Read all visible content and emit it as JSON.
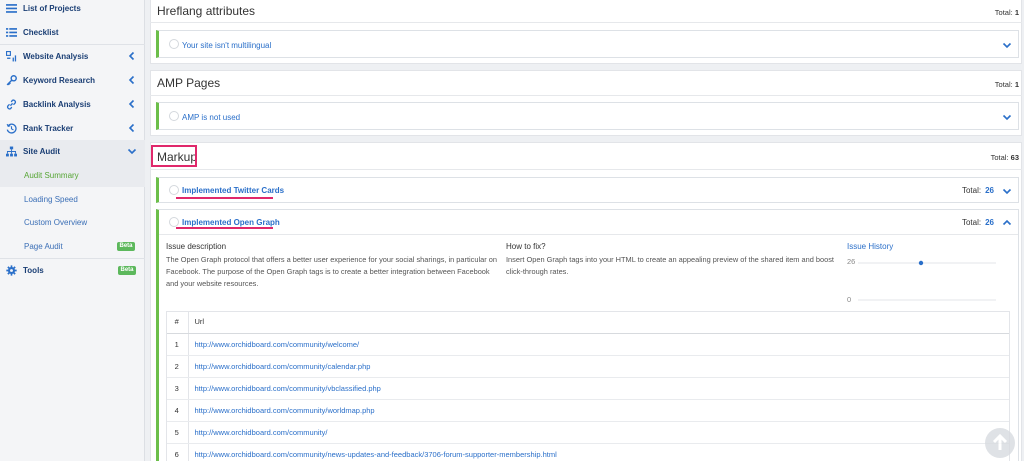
{
  "sidebar": {
    "items": [
      {
        "label": "List of Projects",
        "icon": "list-icon"
      },
      {
        "label": "Checklist",
        "icon": "checklist-icon"
      },
      {
        "label": "Website Analysis",
        "icon": "website-analysis-icon"
      },
      {
        "label": "Keyword Research",
        "icon": "key-icon"
      },
      {
        "label": "Backlink Analysis",
        "icon": "link-icon"
      },
      {
        "label": "Rank Tracker",
        "icon": "history-icon"
      },
      {
        "label": "Site Audit",
        "icon": "sitemap-icon"
      },
      {
        "label": "Tools",
        "icon": "gear-icon"
      }
    ],
    "site_audit_sub": [
      "Audit Summary",
      "Loading Speed",
      "Custom Overview",
      "Page Audit"
    ],
    "beta_label": "Beta"
  },
  "hreflang": {
    "title": "Hreflang attributes",
    "total_label": "Total:",
    "total": "1",
    "issue": "Your site isn't multilingual"
  },
  "amp": {
    "title": "AMP Pages",
    "total_label": "Total:",
    "total": "1",
    "issue": "AMP is not used"
  },
  "markup": {
    "title": "Markup",
    "total_label": "Total:",
    "total": "63",
    "issues": [
      {
        "label": "Implemented Twitter Cards",
        "total_label": "Total:",
        "total": "26"
      },
      {
        "label": "Implemented Open Graph",
        "total_label": "Total:",
        "total": "26"
      }
    ]
  },
  "detail": {
    "desc_header": "Issue description",
    "desc_text_1": "The Open Graph protocol that offers a better user experience for your social sharings, in particular on",
    "desc_text_2": "Facebook. The purpose of the Open Graph tags is to create a better integration between Facebook",
    "desc_text_3": "and your website resources.",
    "fix_header": "How to fix?",
    "fix_text_1": "Insert Open Graph tags into your HTML to create an appealing preview of the shared item and boost",
    "fix_text_2": "click-through rates.",
    "history_label": "Issue History",
    "history_max": "26",
    "history_min": "0",
    "history_value": 26
  },
  "table": {
    "col_num": "#",
    "col_url": "Url",
    "rows": [
      {
        "n": "1",
        "url": "http://www.orchidboard.com/community/welcome/"
      },
      {
        "n": "2",
        "url": "http://www.orchidboard.com/community/calendar.php"
      },
      {
        "n": "3",
        "url": "http://www.orchidboard.com/community/vbclassified.php"
      },
      {
        "n": "4",
        "url": "http://www.orchidboard.com/community/worldmap.php"
      },
      {
        "n": "5",
        "url": "http://www.orchidboard.com/community/"
      },
      {
        "n": "6",
        "url": "http://www.orchidboard.com/community/news-updates-and-feedback/3706-forum-supporter-membership.html"
      }
    ]
  },
  "colors": {
    "accent": "#2a6fc9",
    "highlight": "#e0286b",
    "success": "#6cbf4a"
  }
}
